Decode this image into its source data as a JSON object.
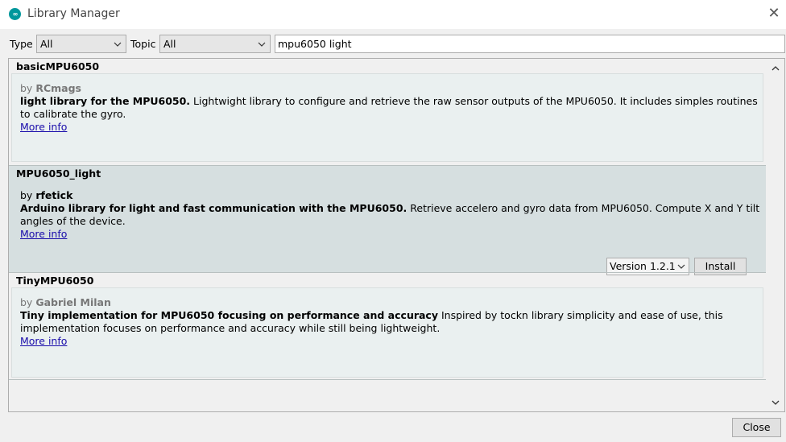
{
  "window": {
    "title": "Library Manager",
    "logo_text": "∞"
  },
  "filters": {
    "type_label": "Type",
    "type_value": "All",
    "topic_label": "Topic",
    "topic_value": "All",
    "search_value": "mpu6050 light"
  },
  "libraries": [
    {
      "name": "basicMPU6050",
      "by_prefix": "by",
      "author": "RCmags",
      "summary": "light library for the MPU6050.",
      "description": " Lightwight library to configure and retrieve the raw sensor outputs of the MPU6050. It includes simples routines to calibrate the gyro.",
      "more_info": "More info"
    },
    {
      "name": "MPU6050_light",
      "by_prefix": "by",
      "author": "rfetick",
      "summary": "Arduino library for light and fast communication with the MPU6050.",
      "description": " Retrieve accelero and gyro data from MPU6050. Compute X and Y tilt angles of the device.",
      "more_info": "More info",
      "version": "Version 1.2.1",
      "install_label": "Install"
    },
    {
      "name": "TinyMPU6050",
      "by_prefix": "by",
      "author": "Gabriel Milan",
      "summary": "Tiny implementation for MPU6050 focusing on performance and accuracy",
      "description": " Inspired by tockn library simplicity and ease of use, this implementation focuses on performance and accuracy while still being lightweight.",
      "more_info": "More info"
    }
  ],
  "footer": {
    "close_label": "Close"
  },
  "colors": {
    "accent": "#00979c",
    "link": "#1a0dab",
    "selected_bg": "#d6dfe0"
  }
}
